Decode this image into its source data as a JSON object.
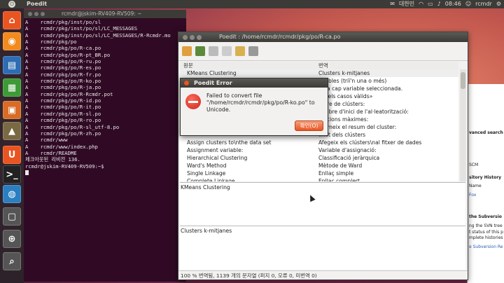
{
  "top_panel": {
    "app_title": "Poedit",
    "keyboard": "대한민",
    "clock": "08:46",
    "user": "rcmdr"
  },
  "terminal": {
    "title": "rcmdr@jskim-RV409-RV509: ~",
    "lines": [
      "A    rcmdr/pkg/inst/po/sl",
      "A    rcmdr/pkg/inst/po/sl/LC_MESSAGES",
      "A    rcmdr/pkg/inst/po/sl/LC_MESSAGES/R-Rcmdr.mo",
      "A    rcmdr/pkg/po",
      "A    rcmdr/pkg/po/R-ca.po",
      "A    rcmdr/pkg/po/R-pt_BR.po",
      "A    rcmdr/pkg/po/R-ru.po",
      "A    rcmdr/pkg/po/R-es.po",
      "A    rcmdr/pkg/po/R-fr.po",
      "A    rcmdr/pkg/po/R-ko.po",
      "A    rcmdr/pkg/po/R-ja.po",
      "A    rcmdr/pkg/po/R-Rcmdr.pot",
      "A    rcmdr/pkg/po/R-id.po",
      "A    rcmdr/pkg/po/R-it.po",
      "A    rcmdr/pkg/po/R-sl.po",
      "A    rcmdr/pkg/po/R-ro.po",
      "A    rcmdr/pkg/po/R-sl_utf-8.po",
      "A    rcmdr/pkg/po/R-zh.po",
      "A    rcmdr/www",
      "A    rcmdr/www/index.php",
      "A    rcmdr/README",
      "체크아웃된 리비전 136.",
      "rcmdr@jskim-RV409-RV509:~$ "
    ]
  },
  "poedit": {
    "title": "Poedit : /home/rcmdr/rcmdr/pkg/po/R-ca.po",
    "col_source": "원문",
    "col_translation": "번역",
    "rows": [
      {
        "src": "KMeans Clustering",
        "tr": "Clusters k-mitjanes"
      },
      {
        "src": "",
        "tr": "...iables (triï'n una o més)"
      },
      {
        "src": "",
        "tr": "...ha cap variable seleccionada."
      },
      {
        "src": "",
        "tr": "...s els casos vàlids»"
      },
      {
        "src": "",
        "tr": "...bre de clústers:"
      },
      {
        "src": "",
        "tr": "...mbre d'inici de l'al·leatorització:"
      },
      {
        "src": "",
        "tr": "...acions màximes:"
      },
      {
        "src": "",
        "tr": "...rimeix el resum del cluster:"
      },
      {
        "src": "",
        "tr": "...lot dels clústers"
      },
      {
        "src": "Assign clusters to\\nthe data set",
        "tr": "Afegeix els clústers\\nal fitxer de dades"
      },
      {
        "src": "Assignment variable:",
        "tr": "Variable d'assignació:"
      },
      {
        "src": "Hierarchical Clustering",
        "tr": "Classificació jeràrquica"
      },
      {
        "src": "Ward's Method",
        "tr": "Mètode de Ward"
      },
      {
        "src": "Single Linkage",
        "tr": "Enllaç simple"
      },
      {
        "src": "Complete Linkage",
        "tr": "Enllaç complert"
      }
    ],
    "source_pane": "KMeans Clustering",
    "translation_pane": "Clusters k-mitjanes",
    "status": "100 % 번역됨, 1139 개의 문자열 (퍼지 0, 오류 0, 미번역 0)"
  },
  "browser": {
    "snippets": [
      "vanced search",
      "SCM",
      "sitory History",
      "Name",
      "Fox",
      "the Subversio",
      "ng the SVN tree",
      "t status of this p",
      "mplete histories",
      "e Subversion Re"
    ]
  },
  "dialog": {
    "title": "Poedit Error",
    "message": "Failed to convert file \"/home/rcmdr/rcmdr/pkg/po/R-ko.po\" to Unicode.",
    "ok_label": "확인(O)"
  },
  "colors": {
    "accent": "#e95420",
    "terminal_bg": "#300a24"
  }
}
